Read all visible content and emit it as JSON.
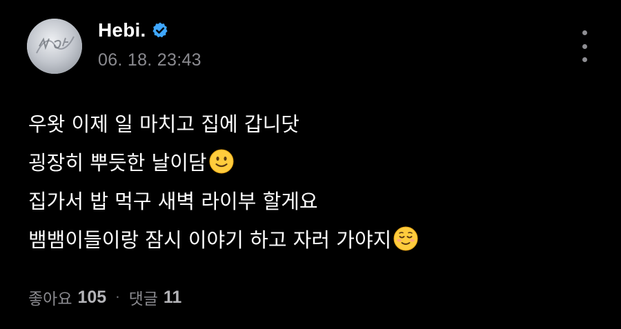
{
  "author": {
    "name": "Hebi.",
    "verified": true,
    "avatar_icon": "profile-photo"
  },
  "timestamp": "06. 18. 23:43",
  "menu_icon": "more-vertical-icon",
  "post": {
    "lines": [
      {
        "text": "우왓 이제 일 마치고 집에 갑니닷",
        "emoji": ""
      },
      {
        "text": "굉장히 뿌듯한 날이담",
        "emoji": "slightly-smiling-face"
      },
      {
        "text": "집가서 밥 먹구 새벽 라이부 할게요",
        "emoji": ""
      },
      {
        "text": "뱀뱀이들이랑 잠시 이야기 하고 자러 가야지",
        "emoji": "relieved-face"
      }
    ]
  },
  "footer": {
    "likes_label": "좋아요",
    "likes_count": "105",
    "separator": "·",
    "comments_label": "댓글",
    "comments_count": "11"
  },
  "colors": {
    "background": "#000000",
    "text": "#ffffff",
    "muted": "#8a8a8f",
    "verified_badge": "#3fa7ff"
  }
}
